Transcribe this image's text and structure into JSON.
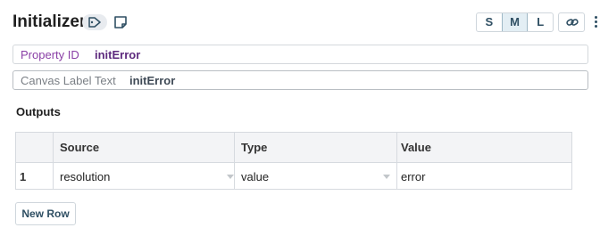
{
  "header": {
    "title": "Initializer",
    "sizes": [
      "S",
      "M",
      "L"
    ],
    "active_size": "M"
  },
  "fields": {
    "property_id": {
      "label": "Property ID",
      "value": "initError"
    },
    "canvas_label": {
      "label": "Canvas Label Text",
      "value": "initError"
    }
  },
  "outputs": {
    "title": "Outputs",
    "columns": [
      "Source",
      "Type",
      "Value"
    ],
    "rows": [
      {
        "num": "1",
        "source": "resolution",
        "type": "value",
        "value": "error"
      }
    ],
    "new_row_label": "New Row"
  },
  "colors": {
    "property_label": "#8a3fa6",
    "accent": "#2f4f63",
    "border": "#d6dadf"
  },
  "icons": [
    "tag-icon",
    "note-icon",
    "link-icon",
    "more-vertical-icon",
    "dropdown-caret-icon"
  ]
}
